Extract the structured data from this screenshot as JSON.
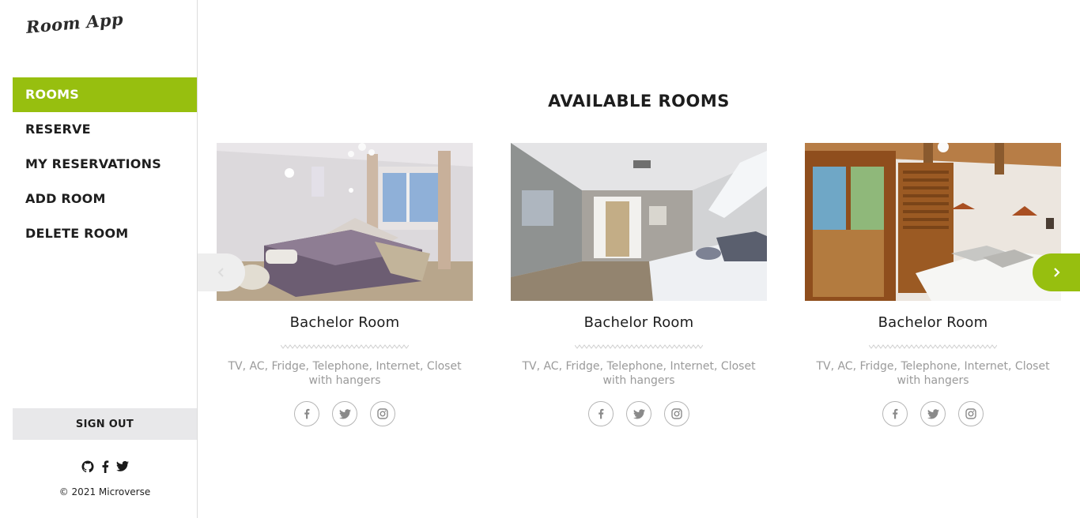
{
  "sidebar": {
    "logo": "Room App",
    "nav": [
      {
        "label": "ROOMS",
        "active": true
      },
      {
        "label": "RESERVE",
        "active": false
      },
      {
        "label": "MY RESERVATIONS",
        "active": false
      },
      {
        "label": "ADD ROOM",
        "active": false
      },
      {
        "label": "DELETE ROOM",
        "active": false
      }
    ],
    "signout_label": "SIGN OUT",
    "social_icons": [
      "github-icon",
      "facebook-icon",
      "twitter-icon"
    ],
    "copyright": "© 2021 Microverse"
  },
  "main": {
    "title": "AVAILABLE ROOMS",
    "rooms": [
      {
        "name": "Bachelor Room",
        "description": "TV, AC, Fridge, Telephone, Internet, Closet with hangers",
        "socials": [
          "facebook-icon",
          "twitter-icon",
          "instagram-icon"
        ]
      },
      {
        "name": "Bachelor Room",
        "description": "TV, AC, Fridge, Telephone, Internet, Closet with hangers",
        "socials": [
          "facebook-icon",
          "twitter-icon",
          "instagram-icon"
        ]
      },
      {
        "name": "Bachelor Room",
        "description": "TV, AC, Fridge, Telephone, Internet, Closet with hangers",
        "socials": [
          "facebook-icon",
          "twitter-icon",
          "instagram-icon"
        ]
      }
    ],
    "carousel": {
      "prev_icon": "chevron-left-icon",
      "next_icon": "chevron-right-icon"
    }
  },
  "colors": {
    "accent": "#97bf0f",
    "signout_bg": "#e8e8ea",
    "muted_text": "#9a9a9a"
  }
}
